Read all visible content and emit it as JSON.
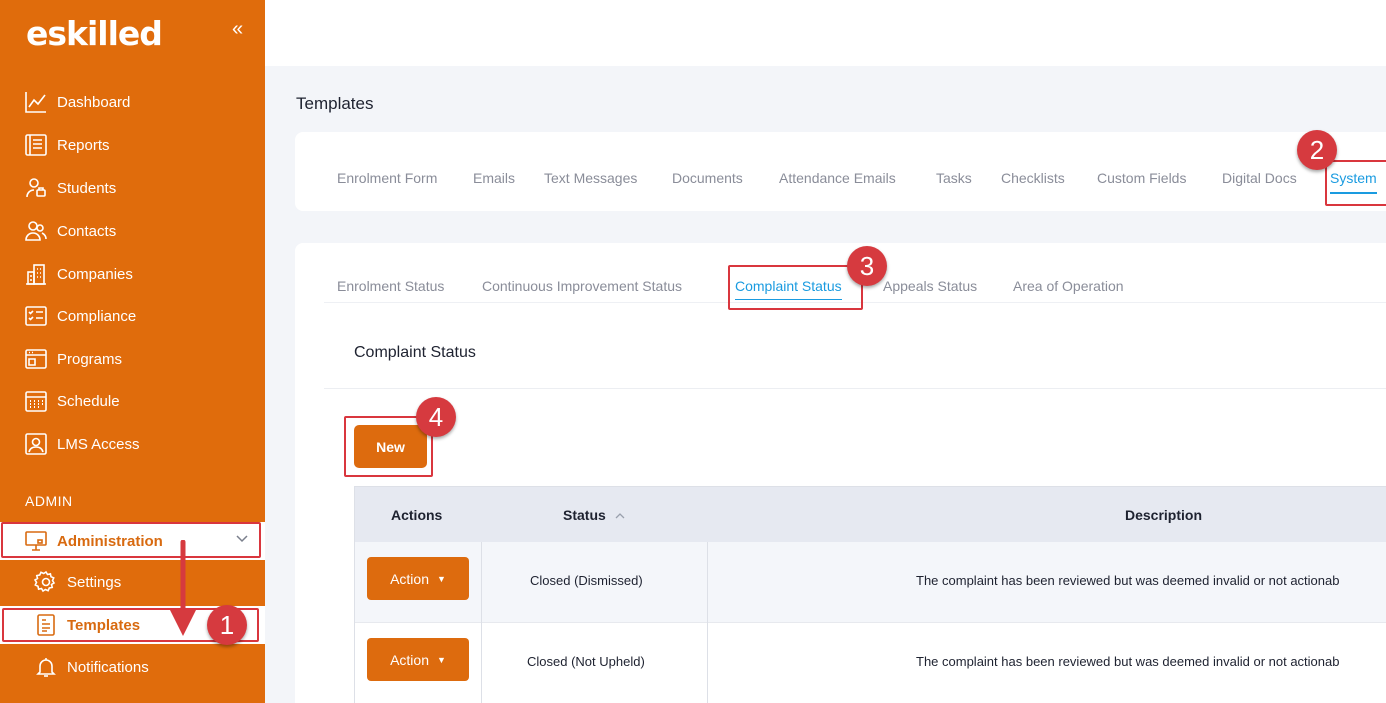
{
  "brand": {
    "logo": "eskilled",
    "accent": "#e06c0c",
    "link_blue": "#1a9be0",
    "annotation_red": "#d63a3f"
  },
  "sidebar": {
    "collapse_icon": "double-chevron-left-icon",
    "items": [
      {
        "label": "Dashboard",
        "icon": "chart-line-icon"
      },
      {
        "label": "Reports",
        "icon": "report-icon"
      },
      {
        "label": "Students",
        "icon": "students-icon"
      },
      {
        "label": "Contacts",
        "icon": "contacts-icon"
      },
      {
        "label": "Companies",
        "icon": "building-icon"
      },
      {
        "label": "Compliance",
        "icon": "checklist-icon"
      },
      {
        "label": "Programs",
        "icon": "window-icon"
      },
      {
        "label": "Schedule",
        "icon": "calendar-icon"
      },
      {
        "label": "LMS Access",
        "icon": "user-screen-icon"
      }
    ],
    "section_label": "ADMIN",
    "admin": {
      "label": "Administration",
      "icon": "monitor-icon"
    },
    "sub_items": [
      {
        "label": "Settings",
        "icon": "gear-icon"
      },
      {
        "label": "Templates",
        "icon": "document-icon"
      },
      {
        "label": "Notifications",
        "icon": "bell-icon"
      }
    ]
  },
  "main": {
    "page_title": "Templates",
    "tabs": [
      "Enrolment Form",
      "Emails",
      "Text Messages",
      "Documents",
      "Attendance Emails",
      "Tasks",
      "Checklists",
      "Custom Fields",
      "Digital Docs",
      "System"
    ],
    "active_tab": "System",
    "subtabs": [
      "Enrolment Status",
      "Continuous Improvement Status",
      "Complaint Status",
      "Appeals Status",
      "Area of Operation"
    ],
    "active_subtab": "Complaint Status",
    "section_title": "Complaint Status",
    "new_button": "New",
    "table": {
      "headers": [
        "Actions",
        "Status",
        "Description"
      ],
      "sort_icon": "chevron-up-icon",
      "rows": [
        {
          "action": "Action",
          "status": "Closed (Dismissed)",
          "description": "The complaint has been reviewed but was deemed invalid or not actionab"
        },
        {
          "action": "Action",
          "status": "Closed (Not Upheld)",
          "description": "The complaint has been reviewed but was deemed invalid or not actionab"
        }
      ]
    }
  },
  "annotations": [
    "1",
    "2",
    "3",
    "4"
  ]
}
